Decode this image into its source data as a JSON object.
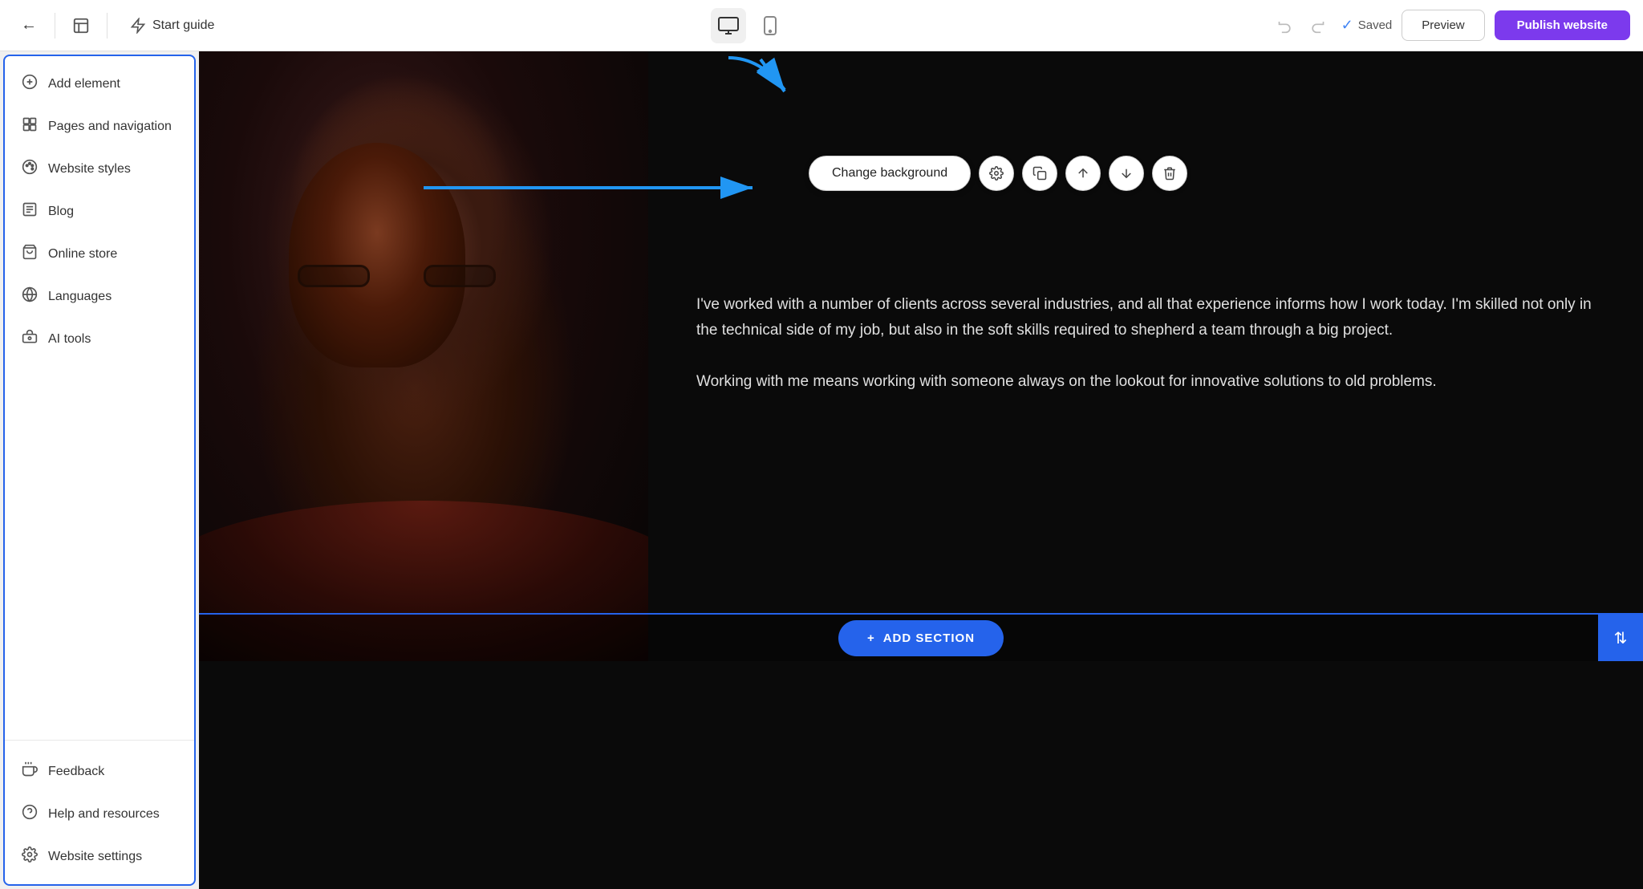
{
  "topbar": {
    "back_icon": "←",
    "layout_icon": "▣",
    "start_guide_label": "Start guide",
    "undo_icon": "↺",
    "redo_icon": "↻",
    "saved_label": "Saved",
    "preview_label": "Preview",
    "publish_label": "Publish website",
    "device_desktop_icon": "💻",
    "device_mobile_icon": "📱"
  },
  "sidebar": {
    "items": [
      {
        "id": "add-element",
        "label": "Add element",
        "icon": "⊕"
      },
      {
        "id": "pages-navigation",
        "label": "Pages and navigation",
        "icon": "◈"
      },
      {
        "id": "website-styles",
        "label": "Website styles",
        "icon": "🎨"
      },
      {
        "id": "blog",
        "label": "Blog",
        "icon": "✏"
      },
      {
        "id": "online-store",
        "label": "Online store",
        "icon": "🛒"
      },
      {
        "id": "languages",
        "label": "Languages",
        "icon": "✦"
      },
      {
        "id": "ai-tools",
        "label": "AI tools",
        "icon": "🤖"
      }
    ],
    "bottom_items": [
      {
        "id": "feedback",
        "label": "Feedback",
        "icon": "📢"
      },
      {
        "id": "help",
        "label": "Help and resources",
        "icon": "❓"
      },
      {
        "id": "settings",
        "label": "Website settings",
        "icon": "⚙"
      }
    ]
  },
  "canvas": {
    "hero": {
      "text1": "I've worked with a number of clients across several industries, and all that experience informs how I work today. I'm skilled not only in the technical side of my job, but also in the soft skills required to shepherd a team through a big project.",
      "text2": "Working with me means working with someone always on the lookout for innovative solutions to old problems."
    }
  },
  "toolbar": {
    "change_bg_label": "Change background",
    "settings_icon": "⚙",
    "copy_icon": "⧉",
    "up_icon": "↑",
    "down_icon": "↓",
    "delete_icon": "🗑"
  },
  "add_section": {
    "label": "+ ADD SECTION"
  }
}
